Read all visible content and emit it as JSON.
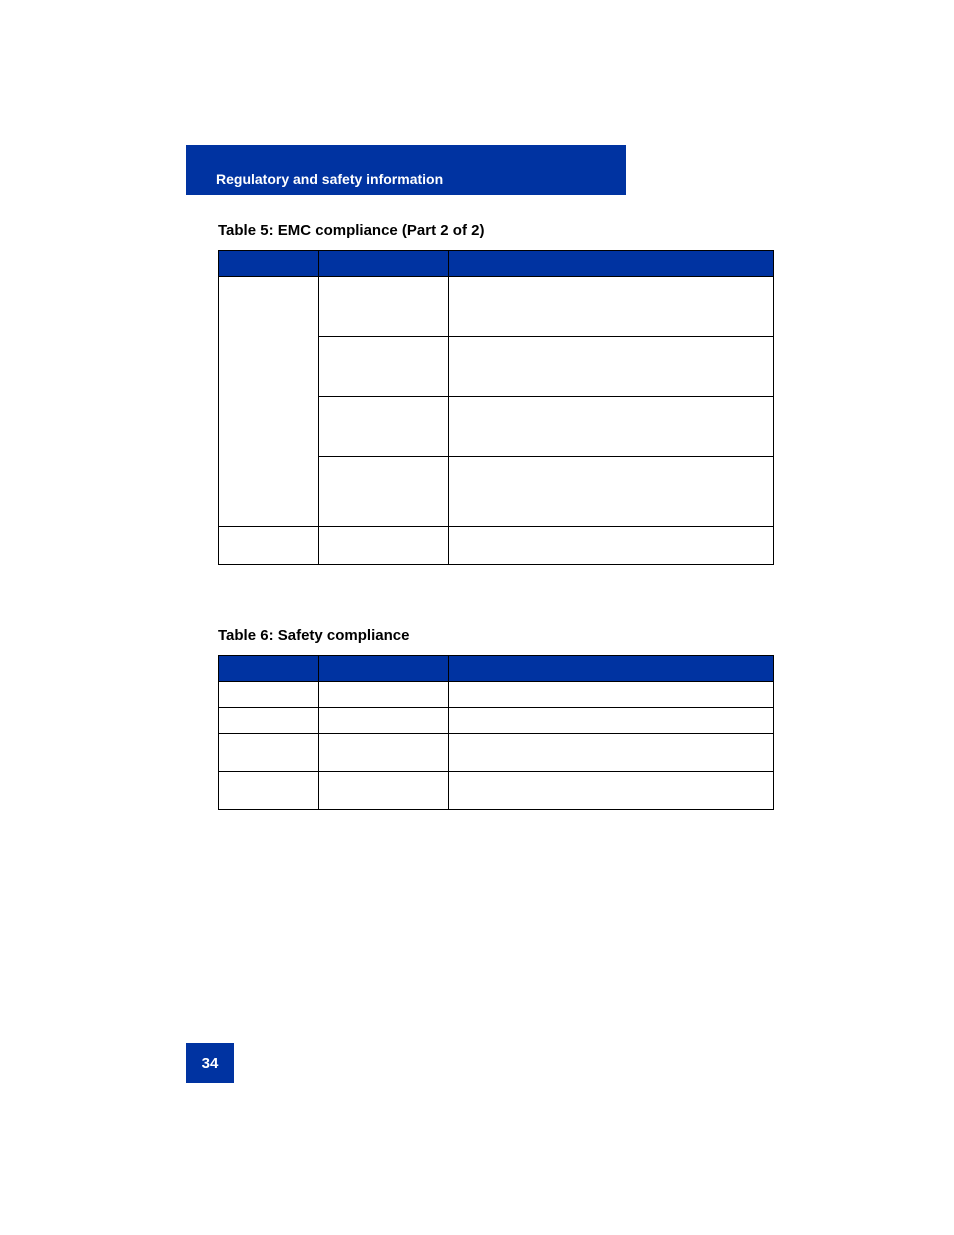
{
  "header": {
    "section_title": "Regulatory and safety information"
  },
  "table5": {
    "caption": "Table 5: EMC compliance (Part 2 of 2)",
    "columns": [
      "",
      "",
      ""
    ],
    "rows": [
      {
        "c1": "",
        "c2": "",
        "c3": "",
        "rowspan_c1": 4
      },
      {
        "c2": "",
        "c3": ""
      },
      {
        "c2": "",
        "c3": ""
      },
      {
        "c2": "",
        "c3": ""
      },
      {
        "c1": "",
        "c2": "",
        "c3": ""
      }
    ]
  },
  "table6": {
    "caption": "Table 6: Safety compliance",
    "columns": [
      "",
      "",
      ""
    ],
    "rows": [
      {
        "c1": "",
        "c2": "",
        "c3": ""
      },
      {
        "c1": "",
        "c2": "",
        "c3": ""
      },
      {
        "c1": "",
        "c2": "",
        "c3": ""
      },
      {
        "c1": "",
        "c2": "",
        "c3": ""
      }
    ]
  },
  "footer": {
    "page_number": "34"
  }
}
